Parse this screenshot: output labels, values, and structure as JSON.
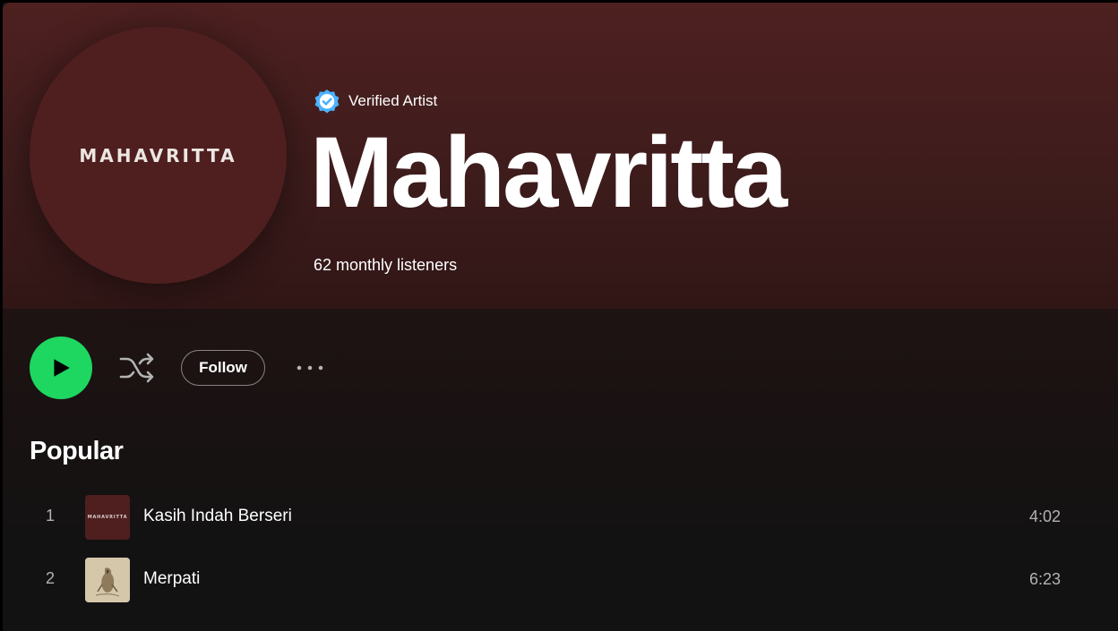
{
  "artist": {
    "verified_label": "Verified Artist",
    "name": "Mahavritta",
    "monthly_listeners": "62 monthly listeners",
    "avatar_logo_text": "MAHAVRITTA"
  },
  "actions": {
    "follow_label": "Follow"
  },
  "popular": {
    "title": "Popular",
    "tracks": [
      {
        "number": "1",
        "title": "Kasih Indah Berseri",
        "duration": "4:02",
        "cover_logo_text": "MAHAVRITTA"
      },
      {
        "number": "2",
        "title": "Merpati",
        "duration": "6:23"
      }
    ]
  },
  "colors": {
    "accent": "#1ed760",
    "hero_bg": "#4e2020",
    "verified_badge": "#4cb3ff",
    "background": "#121212",
    "subdued_text": "#b3b3b3"
  },
  "icons": {
    "verified": "verified-badge-icon",
    "play": "play-icon",
    "shuffle": "shuffle-icon",
    "more": "more-options-icon"
  }
}
